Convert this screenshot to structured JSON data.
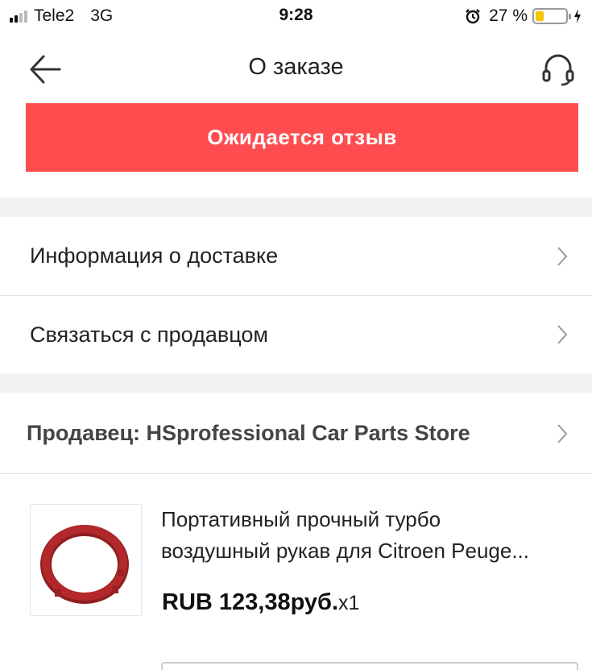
{
  "status_bar": {
    "carrier": "Tele2",
    "network": "3G",
    "time": "9:28",
    "battery_percent": "27 %",
    "battery_level": 0.27,
    "battery_color": "#f4c400",
    "icons": [
      "signal-icon",
      "alarm-icon",
      "battery-icon",
      "charging-icon"
    ]
  },
  "nav": {
    "title": "О заказе",
    "back_icon": "arrow-left-icon",
    "support_icon": "headset-icon"
  },
  "banner": {
    "text": "Ожидается отзыв",
    "color": "#ff4d4f"
  },
  "menu": {
    "items": [
      {
        "label": "Информация о доставке",
        "icon": "chevron-right-icon"
      },
      {
        "label": "Связаться с продавцом",
        "icon": "chevron-right-icon"
      }
    ]
  },
  "seller": {
    "label": "Продавец: HSprofessional Car Parts Store",
    "icon": "chevron-right-icon"
  },
  "product": {
    "title_line1": "Портативный прочный турбо",
    "title_line2": "воздушный рукав для Citroen Peuge...",
    "price": "RUB 123,38руб.",
    "quantity": "x1",
    "image_color": "#b3282a"
  }
}
